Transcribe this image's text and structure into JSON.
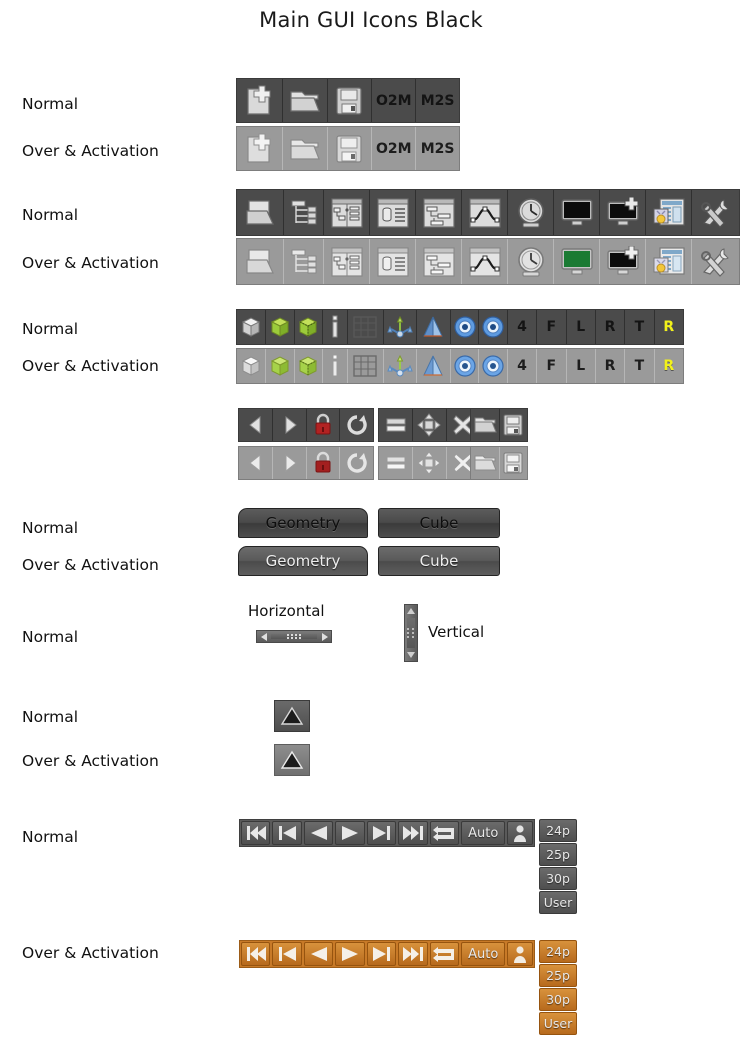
{
  "title": "Main GUI Icons Black",
  "state_labels": {
    "normal": "Normal",
    "over": "Over & Activation"
  },
  "rows": [
    {
      "id": "file-toolbar",
      "normal_label": "Normal",
      "over_label": "Over & Activation",
      "items": [
        {
          "name": "new-file-icon",
          "text": ""
        },
        {
          "name": "open-folder-icon",
          "text": ""
        },
        {
          "name": "save-floppy-icon",
          "text": ""
        },
        {
          "name": "o2m-button",
          "text": "O2M"
        },
        {
          "name": "m2s-button",
          "text": "M2S"
        }
      ]
    },
    {
      "id": "window-toolbar",
      "normal_label": "Normal",
      "over_label": "Over & Activation",
      "items": [
        {
          "name": "project-folder-icon",
          "text": ""
        },
        {
          "name": "outliner-icon",
          "text": ""
        },
        {
          "name": "node-editor-icon",
          "text": ""
        },
        {
          "name": "properties-icon",
          "text": ""
        },
        {
          "name": "schematic-icon",
          "text": ""
        },
        {
          "name": "curve-editor-icon",
          "text": ""
        },
        {
          "name": "timeline-clock-icon",
          "text": ""
        },
        {
          "name": "viewport-icon",
          "text": ""
        },
        {
          "name": "add-viewport-icon",
          "text": ""
        },
        {
          "name": "render-settings-icon",
          "text": ""
        },
        {
          "name": "tools-icon",
          "text": ""
        }
      ]
    },
    {
      "id": "display-toolbar",
      "normal_label": "Normal",
      "over_label": "Over & Activation",
      "items": [
        {
          "name": "shaded-cube-icon",
          "text": ""
        },
        {
          "name": "solid-cube-icon",
          "text": ""
        },
        {
          "name": "wire-cube-icon",
          "text": ""
        },
        {
          "name": "info-icon",
          "text": ""
        },
        {
          "name": "grid-icon",
          "text": ""
        },
        {
          "name": "axis-gizmo-icon",
          "text": ""
        },
        {
          "name": "light-cone-icon",
          "text": ""
        },
        {
          "name": "camera-eye-icon",
          "text": ""
        },
        {
          "name": "camera-eye-2-icon",
          "text": ""
        },
        {
          "name": "view-4-button",
          "text": "4"
        },
        {
          "name": "view-front-button",
          "text": "F"
        },
        {
          "name": "view-left-button",
          "text": "L"
        },
        {
          "name": "view-right-button",
          "text": "R"
        },
        {
          "name": "view-top-button",
          "text": "T"
        },
        {
          "name": "view-render-button",
          "text": "R",
          "color": "#f2f21a"
        }
      ]
    },
    {
      "id": "nav-toolbar",
      "normal_label": "",
      "over_label": "",
      "group_a": [
        {
          "name": "back-arrow-icon",
          "text": ""
        },
        {
          "name": "forward-arrow-icon",
          "text": ""
        },
        {
          "name": "lock-icon",
          "text": ""
        },
        {
          "name": "refresh-icon",
          "text": ""
        }
      ],
      "group_b": [
        {
          "name": "minimize-icon",
          "text": ""
        },
        {
          "name": "fit-view-icon",
          "text": ""
        },
        {
          "name": "close-icon",
          "text": ""
        }
      ],
      "group_c": [
        {
          "name": "open-folder-icon",
          "text": ""
        },
        {
          "name": "save-floppy-icon",
          "text": ""
        }
      ]
    }
  ],
  "buttons": {
    "normal_label": "Normal",
    "over_label": "Over & Activation",
    "geometry_label": "Geometry",
    "cube_label": "Cube"
  },
  "scrollbars": {
    "row_label": "Normal",
    "horizontal_caption": "Horizontal",
    "vertical_caption": "Vertical"
  },
  "triangle": {
    "normal_label": "Normal",
    "over_label": "Over & Activation",
    "icon_name": "triangle-up-icon"
  },
  "transport": {
    "normal_label": "Normal",
    "over_label": "Over & Activation",
    "controls": [
      {
        "name": "skip-to-start-button",
        "text": ""
      },
      {
        "name": "previous-frame-button",
        "text": ""
      },
      {
        "name": "play-backward-button",
        "text": ""
      },
      {
        "name": "play-forward-button",
        "text": ""
      },
      {
        "name": "next-frame-button",
        "text": ""
      },
      {
        "name": "skip-to-end-button",
        "text": ""
      },
      {
        "name": "loop-button",
        "text": ""
      },
      {
        "name": "auto-key-button",
        "text": "Auto"
      },
      {
        "name": "character-button",
        "text": ""
      }
    ],
    "fps_options": [
      "24p",
      "25p",
      "30p",
      "User"
    ],
    "fps_selected": "24p"
  },
  "colors": {
    "toolbar_dark": "#4b4b4b",
    "toolbar_light": "#9a9a9a",
    "accent_yellow": "#f2f21a",
    "accent_orange": "#c87a28",
    "cube_green": "#9ccb3b",
    "lock_red": "#b22222",
    "screen_green": "#1a7a33"
  }
}
